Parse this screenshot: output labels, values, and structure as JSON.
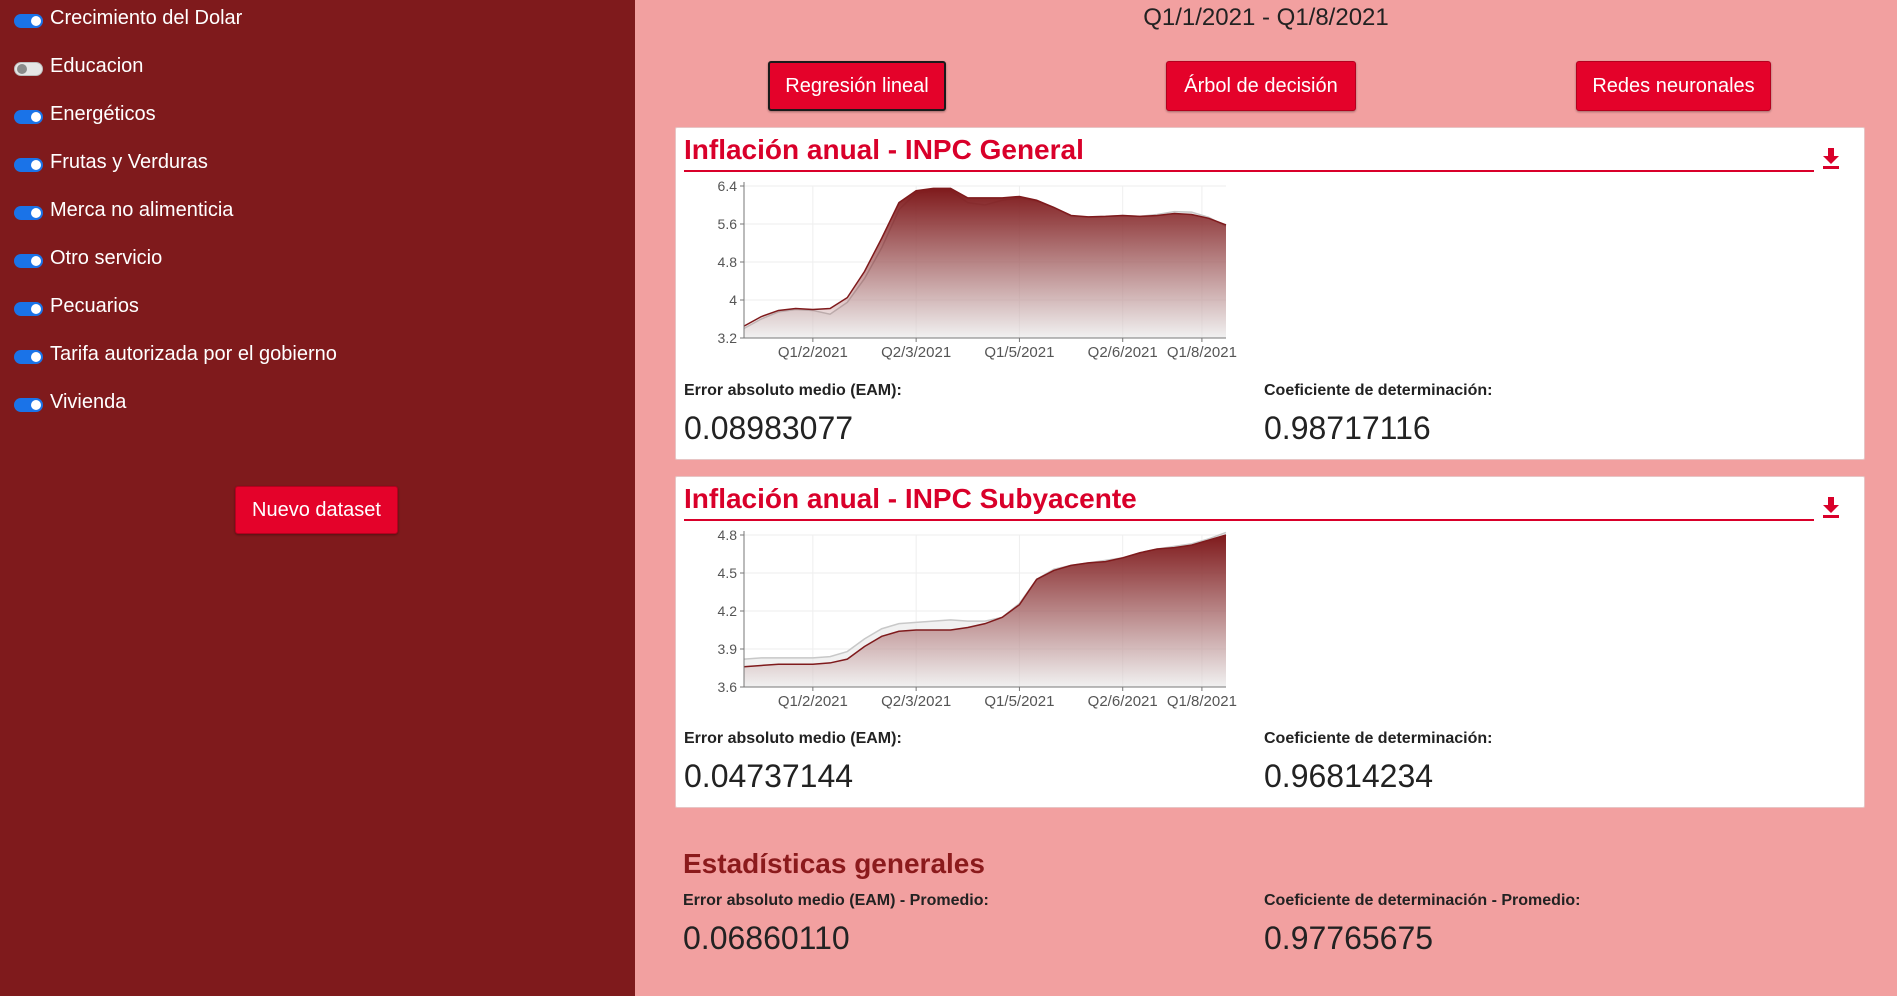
{
  "sidebar": {
    "toggles": [
      {
        "label": "Crecimiento del Dolar",
        "on": true
      },
      {
        "label": "Educacion",
        "on": false
      },
      {
        "label": "Energéticos",
        "on": true
      },
      {
        "label": "Frutas y Verduras",
        "on": true
      },
      {
        "label": "Merca no alimenticia",
        "on": true
      },
      {
        "label": "Otro servicio",
        "on": true
      },
      {
        "label": "Pecuarios",
        "on": true
      },
      {
        "label": "Tarifa autorizada por el gobierno",
        "on": true
      },
      {
        "label": "Vivienda",
        "on": true
      }
    ],
    "new_dataset_label": "Nuevo dataset"
  },
  "header": {
    "range": "Q1/1/2021 - Q1/8/2021"
  },
  "models": {
    "items": [
      "Regresión lineal",
      "Árbol de decisión",
      "Redes neuronales"
    ],
    "selected": "Regresión lineal"
  },
  "cards": [
    {
      "title": "Inflación anual - INPC General",
      "eam_label": "Error absoluto medio (EAM):",
      "eam_value": "0.08983077",
      "r2_label": "Coeficiente de determinación:",
      "r2_value": "0.98717116"
    },
    {
      "title": "Inflación anual - INPC Subyacente",
      "eam_label": "Error absoluto medio (EAM):",
      "eam_value": "0.04737144",
      "r2_label": "Coeficiente de determinación:",
      "r2_value": "0.96814234"
    }
  ],
  "stats": {
    "title": "Estadísticas generales",
    "eam_label": "Error absoluto medio (EAM) - Promedio:",
    "eam_value": "0.06860110",
    "r2_label": "Coeficiente de determinación - Promedio:",
    "r2_value": "0.97765675"
  },
  "colors": {
    "sidebar_bg": "#7f1a1c",
    "main_bg": "#f2a0a0",
    "accent": "#e4022a",
    "series_predicted": "#7f1a1c",
    "series_real": "#c8c8c8"
  },
  "icons": {
    "download": "download-icon"
  },
  "chart_data": [
    {
      "type": "area",
      "x_ticks": [
        "Q1/2/2021",
        "Q2/3/2021",
        "Q1/5/2021",
        "Q2/6/2021",
        "Q1/8/2021"
      ],
      "y_ticks": [
        3.2,
        4,
        4.8,
        5.6,
        6.4
      ],
      "ylim": [
        3.2,
        6.4
      ],
      "x": [
        0,
        0.5,
        1,
        1.5,
        2,
        2.5,
        3,
        3.5,
        4,
        4.5,
        5,
        5.5,
        6,
        6.5,
        7,
        7.5,
        8,
        8.5,
        9,
        9.5,
        10,
        10.5,
        11,
        11.5,
        12,
        12.5,
        13,
        13.5,
        14
      ],
      "xlim": [
        0,
        14
      ],
      "x_tick_positions": [
        2,
        5,
        8,
        11,
        13.3
      ],
      "series": [
        {
          "values": [
            3.45,
            3.65,
            3.78,
            3.82,
            3.8,
            3.82,
            4.05,
            4.6,
            5.3,
            6.05,
            6.3,
            6.35,
            6.35,
            6.15,
            6.15,
            6.15,
            6.18,
            6.1,
            5.95,
            5.78,
            5.75,
            5.76,
            5.78,
            5.76,
            5.78,
            5.82,
            5.8,
            5.72,
            5.58
          ]
        },
        {
          "values": [
            3.4,
            3.6,
            3.75,
            3.8,
            3.78,
            3.7,
            3.95,
            4.45,
            5.1,
            5.9,
            6.25,
            6.3,
            6.3,
            6.05,
            6.0,
            6.1,
            6.15,
            6.08,
            5.95,
            5.76,
            5.75,
            5.76,
            5.78,
            5.76,
            5.8,
            5.86,
            5.85,
            5.74,
            5.55
          ]
        }
      ]
    },
    {
      "type": "area",
      "x_ticks": [
        "Q1/2/2021",
        "Q2/3/2021",
        "Q1/5/2021",
        "Q2/6/2021",
        "Q1/8/2021"
      ],
      "y_ticks": [
        3.6,
        3.9,
        4.2,
        4.5,
        4.8
      ],
      "ylim": [
        3.6,
        4.8
      ],
      "x": [
        0,
        0.5,
        1,
        1.5,
        2,
        2.5,
        3,
        3.5,
        4,
        4.5,
        5,
        5.5,
        6,
        6.5,
        7,
        7.5,
        8,
        8.5,
        9,
        9.5,
        10,
        10.5,
        11,
        11.5,
        12,
        12.5,
        13,
        13.5,
        14
      ],
      "xlim": [
        0,
        14
      ],
      "x_tick_positions": [
        2,
        5,
        8,
        11,
        13.3
      ],
      "series": [
        {
          "values": [
            3.76,
            3.77,
            3.78,
            3.78,
            3.78,
            3.79,
            3.82,
            3.92,
            4.0,
            4.04,
            4.05,
            4.05,
            4.05,
            4.07,
            4.1,
            4.15,
            4.25,
            4.45,
            4.52,
            4.56,
            4.58,
            4.59,
            4.62,
            4.66,
            4.69,
            4.7,
            4.72,
            4.76,
            4.8
          ]
        },
        {
          "values": [
            3.82,
            3.83,
            3.83,
            3.83,
            3.83,
            3.84,
            3.88,
            3.98,
            4.06,
            4.1,
            4.11,
            4.12,
            4.13,
            4.12,
            4.12,
            4.15,
            4.26,
            4.45,
            4.53,
            4.56,
            4.58,
            4.6,
            4.62,
            4.66,
            4.69,
            4.71,
            4.73,
            4.77,
            4.82
          ]
        }
      ]
    }
  ]
}
